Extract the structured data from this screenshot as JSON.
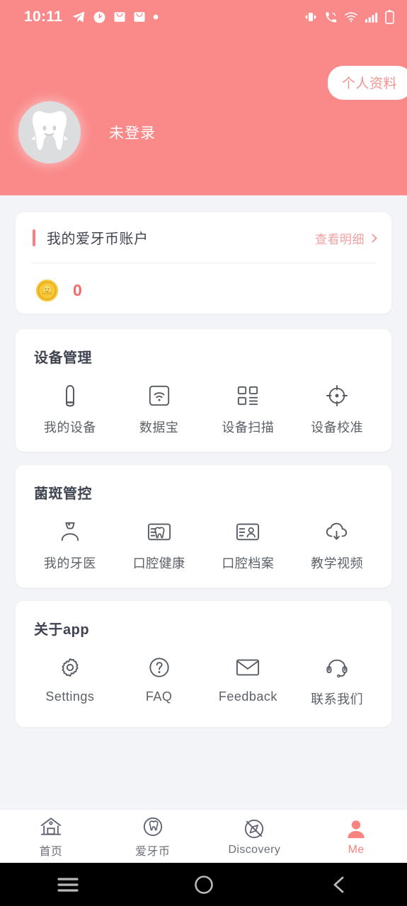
{
  "statusbar": {
    "time": "10:11",
    "left_icons": [
      "telegram-icon",
      "clock-icon",
      "mail-icon",
      "mail-icon",
      "dot-icon"
    ],
    "right_icons": [
      "vibrate-icon",
      "call-signal-icon",
      "wifi-icon",
      "cellular-signal-icon",
      "battery-icon"
    ]
  },
  "header": {
    "profile_button": "个人资料",
    "avatar_icon": "tooth-avatar-icon",
    "username": "未登录",
    "background_color": "#fa8a8a"
  },
  "coin_card": {
    "title": "我的爱牙币账户",
    "detail_link": "查看明细",
    "coin_icon": "gold-coin-icon",
    "balance": "0",
    "accent_color": "#f2817f",
    "balance_color": "#f26a6a"
  },
  "sections": [
    {
      "title": "设备管理",
      "items": [
        {
          "label": "我的设备",
          "icon": "device-toothbrush-icon"
        },
        {
          "label": "数据宝",
          "icon": "wifi-box-icon"
        },
        {
          "label": "设备扫描",
          "icon": "qr-scan-grid-icon"
        },
        {
          "label": "设备校准",
          "icon": "crosshair-target-icon"
        }
      ]
    },
    {
      "title": "菌斑管控",
      "items": [
        {
          "label": "我的牙医",
          "icon": "dentist-person-icon"
        },
        {
          "label": "口腔健康",
          "icon": "card-tooth-icon"
        },
        {
          "label": "口腔档案",
          "icon": "card-person-icon"
        },
        {
          "label": "教学视频",
          "icon": "cloud-download-icon"
        }
      ]
    },
    {
      "title": "关于app",
      "items": [
        {
          "label": "Settings",
          "icon": "gear-icon"
        },
        {
          "label": "FAQ",
          "icon": "question-circle-icon"
        },
        {
          "label": "Feedback",
          "icon": "envelope-icon"
        },
        {
          "label": "联系我们",
          "icon": "headset-icon"
        }
      ]
    }
  ],
  "tabbar": {
    "active_color": "#f8837f",
    "inactive_color": "#6b6f78",
    "tabs": [
      {
        "label": "首页",
        "icon": "home-icon",
        "active": false
      },
      {
        "label": "爱牙币",
        "icon": "tooth-icon",
        "active": false
      },
      {
        "label": "Discovery",
        "icon": "compass-icon",
        "active": false
      },
      {
        "label": "Me",
        "icon": "person-icon",
        "active": true
      }
    ]
  },
  "navbar": {
    "buttons": [
      {
        "icon": "recents-icon"
      },
      {
        "icon": "home-circle-icon"
      },
      {
        "icon": "back-chevron-icon"
      }
    ]
  }
}
